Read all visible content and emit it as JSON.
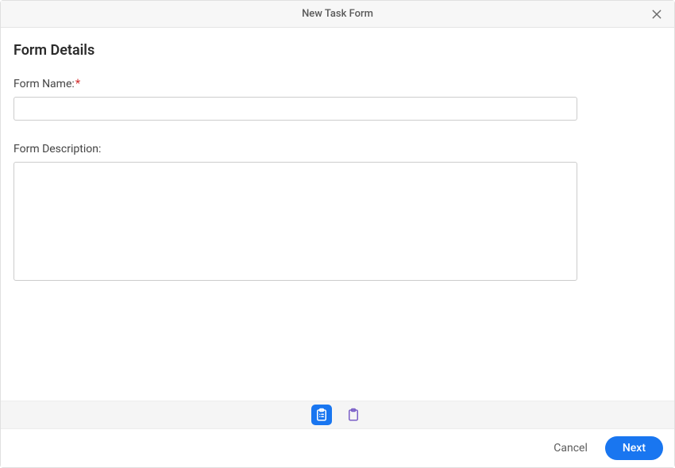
{
  "dialog": {
    "title": "New Task Form"
  },
  "form": {
    "heading": "Form Details",
    "name": {
      "label": "Form Name:",
      "required_mark": "*",
      "value": ""
    },
    "description": {
      "label": "Form Description:",
      "value": ""
    }
  },
  "stepper": {
    "step1_name": "form-details-step",
    "step2_name": "form-fields-step"
  },
  "footer": {
    "cancel": "Cancel",
    "next": "Next"
  }
}
